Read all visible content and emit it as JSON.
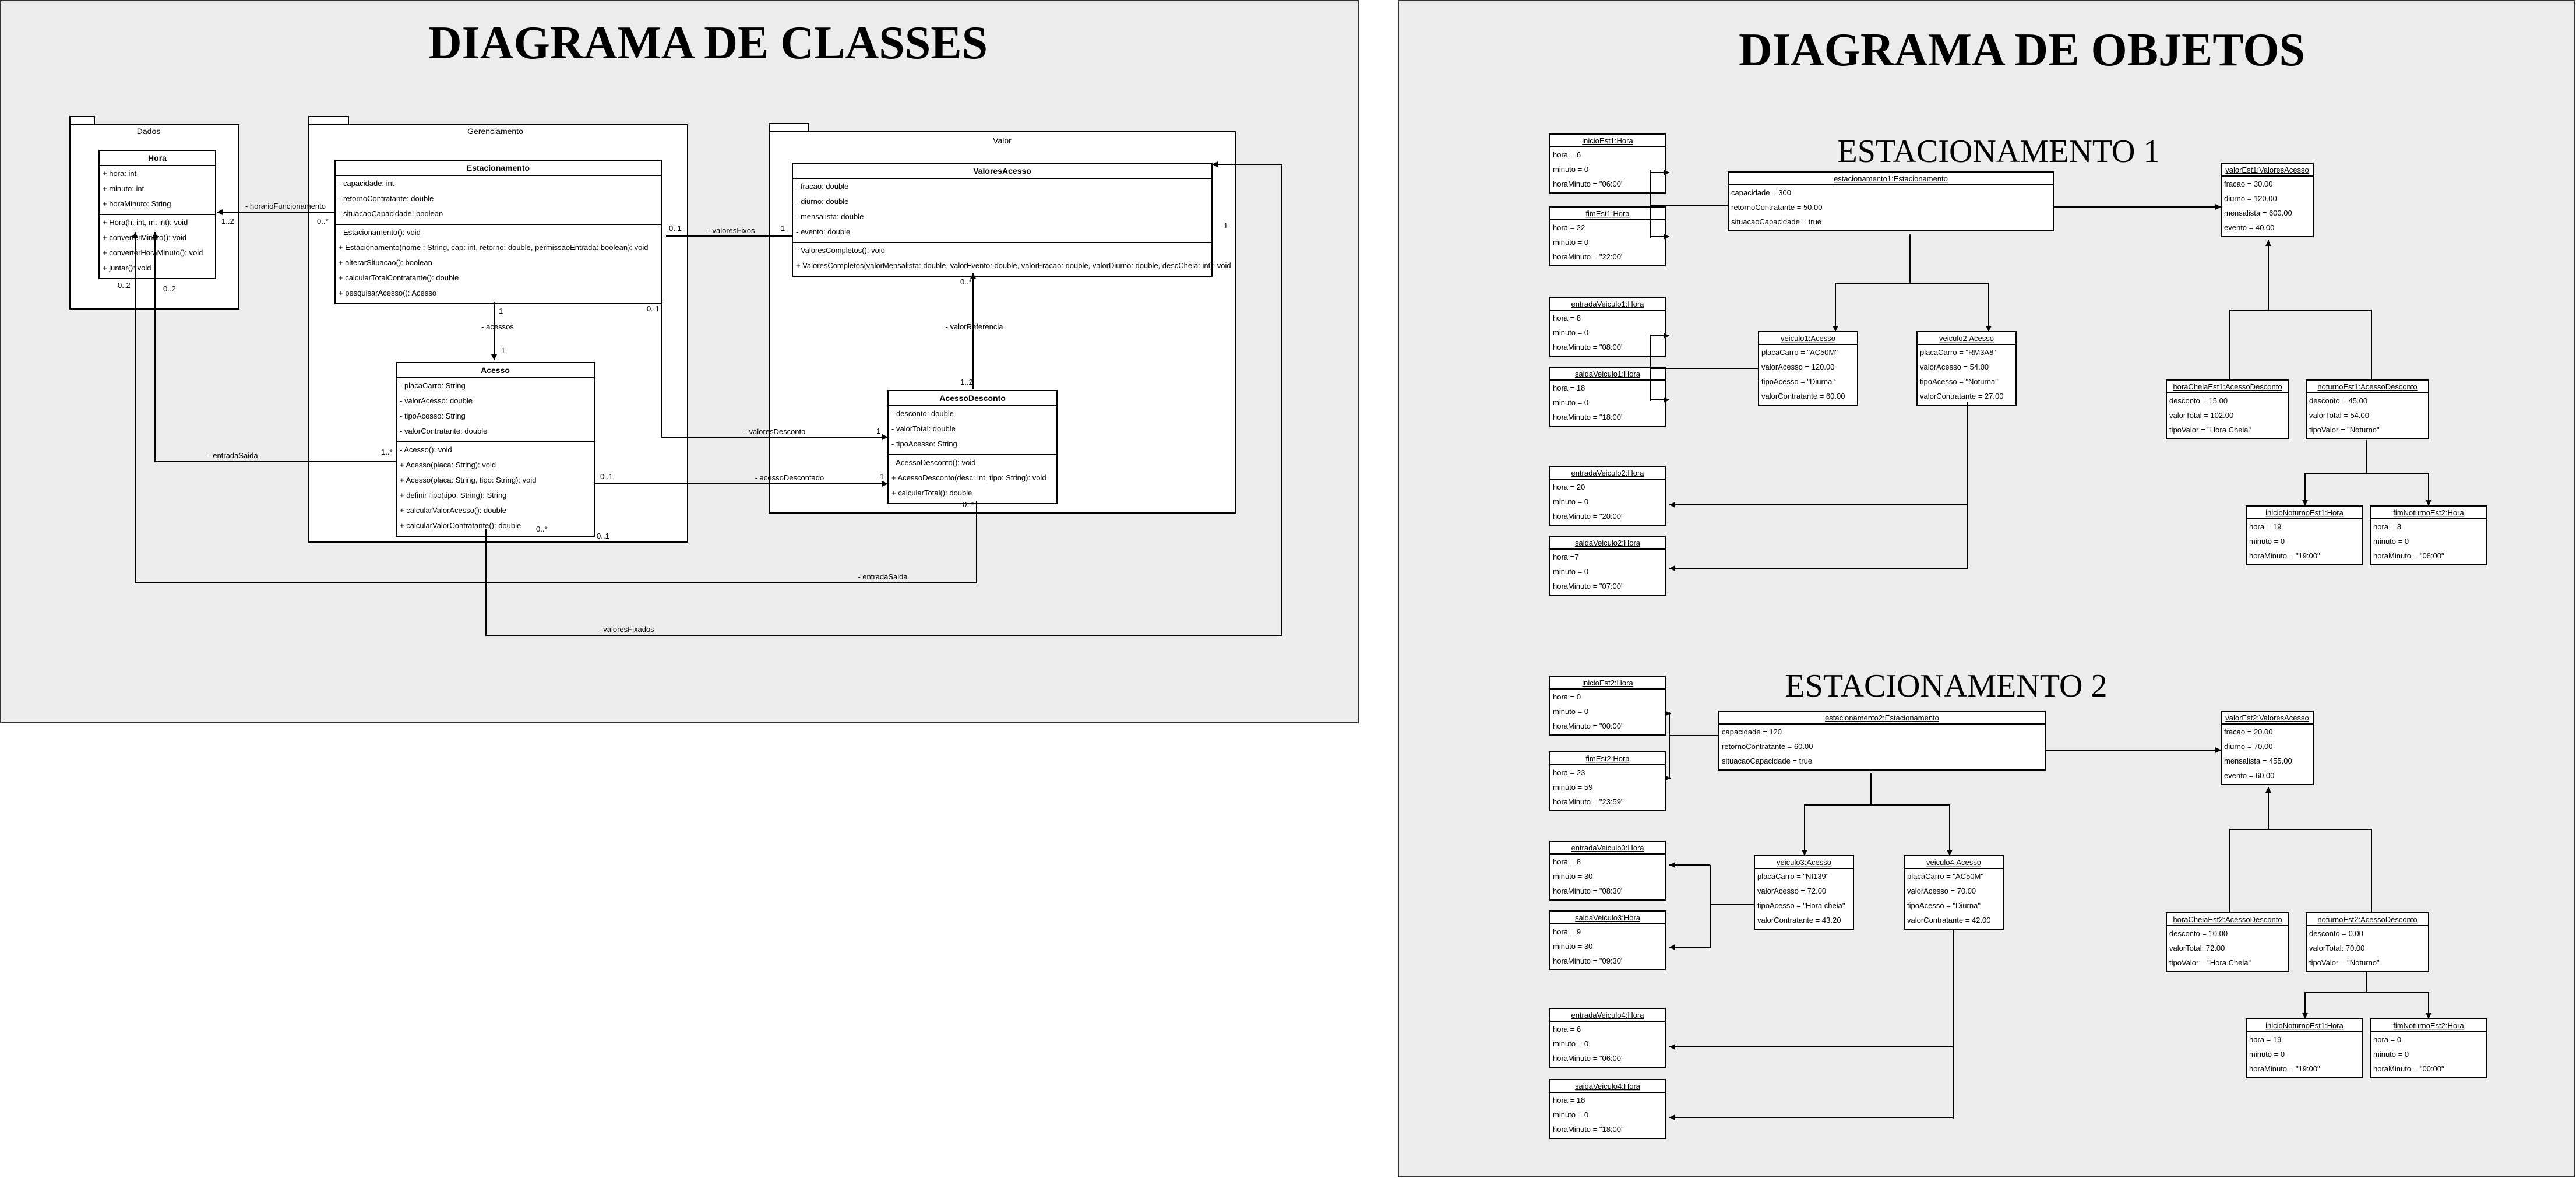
{
  "titles": {
    "classes": "DIAGRAMA DE CLASSES",
    "objects": "DIAGRAMA DE OBJETOS",
    "est1": "ESTACIONAMENTO 1",
    "est2": "ESTACIONAMENTO 2"
  },
  "packages": {
    "dados": "Dados",
    "gerenciamento": "Gerenciamento",
    "valor": "Valor"
  },
  "classes": {
    "hora": {
      "name": "Hora",
      "attrs": [
        "+ hora: int",
        "+ minuto: int",
        "+ horaMinuto: String"
      ],
      "ops": [
        "+ Hora(h: int, m: int): void",
        "+ converterMinuto(): void",
        "+ converterHoraMinuto(): void",
        "+ juntar(): void"
      ]
    },
    "estacionamento": {
      "name": "Estacionamento",
      "attrs": [
        "- capacidade: int",
        "- retornoContratante: double",
        "- situacaoCapacidade: boolean"
      ],
      "ops": [
        "- Estacionamento(): void",
        "+ Estacionamento(nome : String, cap: int, retorno: double, permissaoEntrada: boolean): void",
        "+ alterarSituacao(): boolean",
        "+ calcularTotalContratante(): double",
        "+ pesquisarAcesso(): Acesso"
      ]
    },
    "acesso": {
      "name": "Acesso",
      "attrs": [
        "- placaCarro: String",
        "- valorAcesso: double",
        "- tipoAcesso: String",
        "- valorContratante: double"
      ],
      "ops": [
        "- Acesso(): void",
        "+ Acesso(placa: String): void",
        "+ Acesso(placa: String, tipo: String): void",
        "+ definirTipo(tipo: String): String",
        "+ calcularValorAcesso(): double",
        "+ calcularValorContratante(): double"
      ]
    },
    "valores": {
      "name": "ValoresAcesso",
      "attrs": [
        "- fracao: double",
        "- diurno: double",
        "- mensalista: double",
        "- evento: double"
      ],
      "ops": [
        "- ValoresCompletos(): void",
        "+ ValoresCompletos(valorMensalista: double, valorEvento: double, valorFracao: double, valorDiurno: double, descCheia: int): void"
      ]
    },
    "desconto": {
      "name": "AcessoDesconto",
      "attrs": [
        "- desconto: double",
        "- valorTotal: double",
        "- tipoAcesso: String"
      ],
      "ops": [
        "- AcessoDesconto(): void",
        "+ AcessoDesconto(desc: int, tipo: String): void",
        "+ calcularTotal(): double"
      ]
    }
  },
  "assoc_labels": {
    "horarioFuncionamento": "- horarioFuncionamento",
    "valoresFixos": "- valoresFixos",
    "acessos": "- acessos",
    "valorReferencia": "- valorReferencia",
    "valoresDesconto": "- valoresDesconto",
    "entradaSaida": "- entradaSaida",
    "acessoDescontado": "- acessoDescontado",
    "entradaSaida2": "- entradaSaida",
    "valoresFixados": "- valoresFixados"
  },
  "mult": {
    "m1": "1..2",
    "m2": "0..*",
    "m3": "0..1",
    "m4": "1",
    "m5": "1",
    "m6": "0..1",
    "m7": "1",
    "m8": "0..*",
    "m9": "0..*",
    "m10": "1..2",
    "m11": "1",
    "m12": "1..*",
    "m13": "0..2",
    "m14": "0..2",
    "m15": "0..1",
    "m16": "1",
    "m17": "0..*",
    "m18": "0..1",
    "m19": "1"
  },
  "objects": {
    "inicioEst1": {
      "name": "inicioEst1:Hora",
      "rows": [
        "hora = 6",
        "minuto = 0",
        "horaMinuto = \"06:00\""
      ]
    },
    "fimEst1": {
      "name": "fimEst1:Hora",
      "rows": [
        "hora = 22",
        "minuto = 0",
        "horaMinuto = \"22:00\""
      ]
    },
    "est1": {
      "name": "estacionamento1:Estacionamento",
      "rows": [
        "capacidade = 300",
        "retornoContratante = 50.00",
        "situacaoCapacidade = true"
      ]
    },
    "valorEst1": {
      "name": "valorEst1:ValoresAcesso",
      "rows": [
        "fracao = 30.00",
        "diurno = 120.00",
        "mensalista = 600.00",
        "evento = 40.00"
      ]
    },
    "entradaV1": {
      "name": "entradaVeiculo1:Hora",
      "rows": [
        "hora = 8",
        "minuto = 0",
        "horaMinuto = \"08:00\""
      ]
    },
    "saidaV1": {
      "name": "saidaVeiculo1:Hora",
      "rows": [
        "hora = 18",
        "minuto = 0",
        "horaMinuto = \"18:00\""
      ]
    },
    "veiculo1": {
      "name": "veiculo1:Acesso",
      "rows": [
        "placaCarro = \"AC50M\"",
        "valorAcesso = 120.00",
        "tipoAcesso = \"Diurna\"",
        "valorContratante = 60.00"
      ]
    },
    "veiculo2": {
      "name": "veiculo2:Acesso",
      "rows": [
        "placaCarro = \"RM3A8\"",
        "valorAcesso = 54.00",
        "tipoAcesso = \"Noturna\"",
        "valorContratante = 27.00"
      ]
    },
    "entradaV2": {
      "name": "entradaVeiculo2:Hora",
      "rows": [
        "hora = 20",
        "minuto = 0",
        "horaMinuto = \"20:00\""
      ]
    },
    "saidaV2": {
      "name": "saidaVeiculo2:Hora",
      "rows": [
        "hora =7",
        "minuto = 0",
        "horaMinuto = \"07:00\""
      ]
    },
    "horaCheiaEst1": {
      "name": "horaCheiaEst1:AcessoDesconto",
      "rows": [
        "desconto = 15.00",
        "valorTotal = 102.00",
        "tipoValor = \"Hora Cheia\""
      ]
    },
    "noturnoEst1": {
      "name": "noturnoEst1:AcessoDesconto",
      "rows": [
        "desconto = 45.00",
        "valorTotal = 54.00",
        "tipoValor = \"Noturno\""
      ]
    },
    "inicioNot1": {
      "name": "inicioNoturnoEst1:Hora",
      "rows": [
        "hora = 19",
        "minuto = 0",
        "horaMinuto = \"19:00\""
      ]
    },
    "fimNot1": {
      "name": "fimNoturnoEst2:Hora",
      "rows": [
        "hora = 8",
        "minuto = 0",
        "horaMinuto = \"08:00\""
      ]
    },
    "inicioEst2": {
      "name": "inicioEst2:Hora",
      "rows": [
        "hora = 0",
        "minuto = 0",
        "horaMinuto = \"00:00\""
      ]
    },
    "fimEst2": {
      "name": "fimEst2:Hora",
      "rows": [
        "hora = 23",
        "minuto = 59",
        "horaMinuto = \"23:59\""
      ]
    },
    "est2": {
      "name": "estacionamento2:Estacionamento",
      "rows": [
        "capacidade = 120",
        "retornoContratante = 60.00",
        "situacaoCapacidade = true"
      ]
    },
    "valorEst2": {
      "name": "valorEst2:ValoresAcesso",
      "rows": [
        "fracao = 20.00",
        "diurno = 70.00",
        "mensalista = 455.00",
        "evento = 60.00"
      ]
    },
    "entradaV3": {
      "name": "entradaVeiculo3:Hora",
      "rows": [
        "hora = 8",
        "minuto = 30",
        "horaMinuto = \"08:30\""
      ]
    },
    "saidaV3": {
      "name": "saidaVeiculo3:Hora",
      "rows": [
        "hora = 9",
        "minuto = 30",
        "horaMinuto = \"09:30\""
      ]
    },
    "veiculo3": {
      "name": "veiculo3:Acesso",
      "rows": [
        "placaCarro = \"NI139\"",
        "valorAcesso = 72.00",
        "tipoAcesso = \"Hora cheia\"",
        "valorContratante = 43.20"
      ]
    },
    "veiculo4": {
      "name": "veiculo4:Acesso",
      "rows": [
        "placaCarro = \"AC50M\"",
        "valorAcesso = 70.00",
        "tipoAcesso = \"Diurna\"",
        "valorContratante = 42.00"
      ]
    },
    "entradaV4": {
      "name": "entradaVeiculo4:Hora",
      "rows": [
        "hora = 6",
        "minuto = 0",
        "horaMinuto = \"06:00\""
      ]
    },
    "saidaV4": {
      "name": "saidaVeiculo4:Hora",
      "rows": [
        "hora = 18",
        "minuto = 0",
        "horaMinuto = \"18:00\""
      ]
    },
    "horaCheiaEst2": {
      "name": "horaCheiaEst2:AcessoDesconto",
      "rows": [
        "desconto = 10.00",
        "valorTotal: 72.00",
        "tipoValor = \"Hora Cheia\""
      ]
    },
    "noturnoEst2": {
      "name": "noturnoEst2:AcessoDesconto",
      "rows": [
        "desconto = 0.00",
        "valorTotal: 70.00",
        "tipoValor = \"Noturno\""
      ]
    },
    "inicioNot2": {
      "name": "inicioNoturnoEst1:Hora",
      "rows": [
        "hora = 19",
        "minuto = 0",
        "horaMinuto = \"19:00\""
      ]
    },
    "fimNot2": {
      "name": "fimNoturnoEst2:Hora",
      "rows": [
        "hora = 0",
        "minuto = 0",
        "horaMinuto = \"00:00\""
      ]
    }
  }
}
